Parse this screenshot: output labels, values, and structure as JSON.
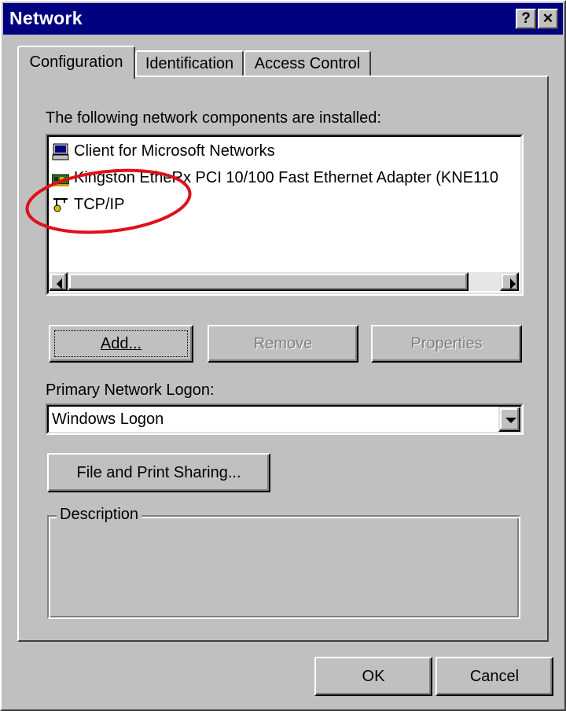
{
  "window": {
    "title": "Network",
    "help_glyph": "?",
    "close_glyph": "✕"
  },
  "tabs": [
    {
      "label": "Configuration",
      "active": true
    },
    {
      "label": "Identification",
      "active": false
    },
    {
      "label": "Access Control",
      "active": false
    }
  ],
  "components": {
    "label": "The following network components are installed:",
    "items": [
      {
        "label": "Client for Microsoft Networks",
        "icon": "network-client-icon"
      },
      {
        "label": "Kingston EtheRx PCI 10/100 Fast Ethernet Adapter (KNE110",
        "icon": "network-adapter-icon"
      },
      {
        "label": "TCP/IP",
        "icon": "protocol-icon"
      }
    ],
    "highlight_color": "#e0101a"
  },
  "buttons": {
    "add": "Add...",
    "remove": "Remove",
    "properties": "Properties",
    "file_print_sharing": "File and Print Sharing...",
    "ok": "OK",
    "cancel": "Cancel"
  },
  "logon": {
    "label": "Primary Network Logon:",
    "value": "Windows Logon"
  },
  "description": {
    "label": "Description",
    "text": ""
  },
  "colors": {
    "face": "#c0c0c0",
    "titlebar": "#000080"
  }
}
